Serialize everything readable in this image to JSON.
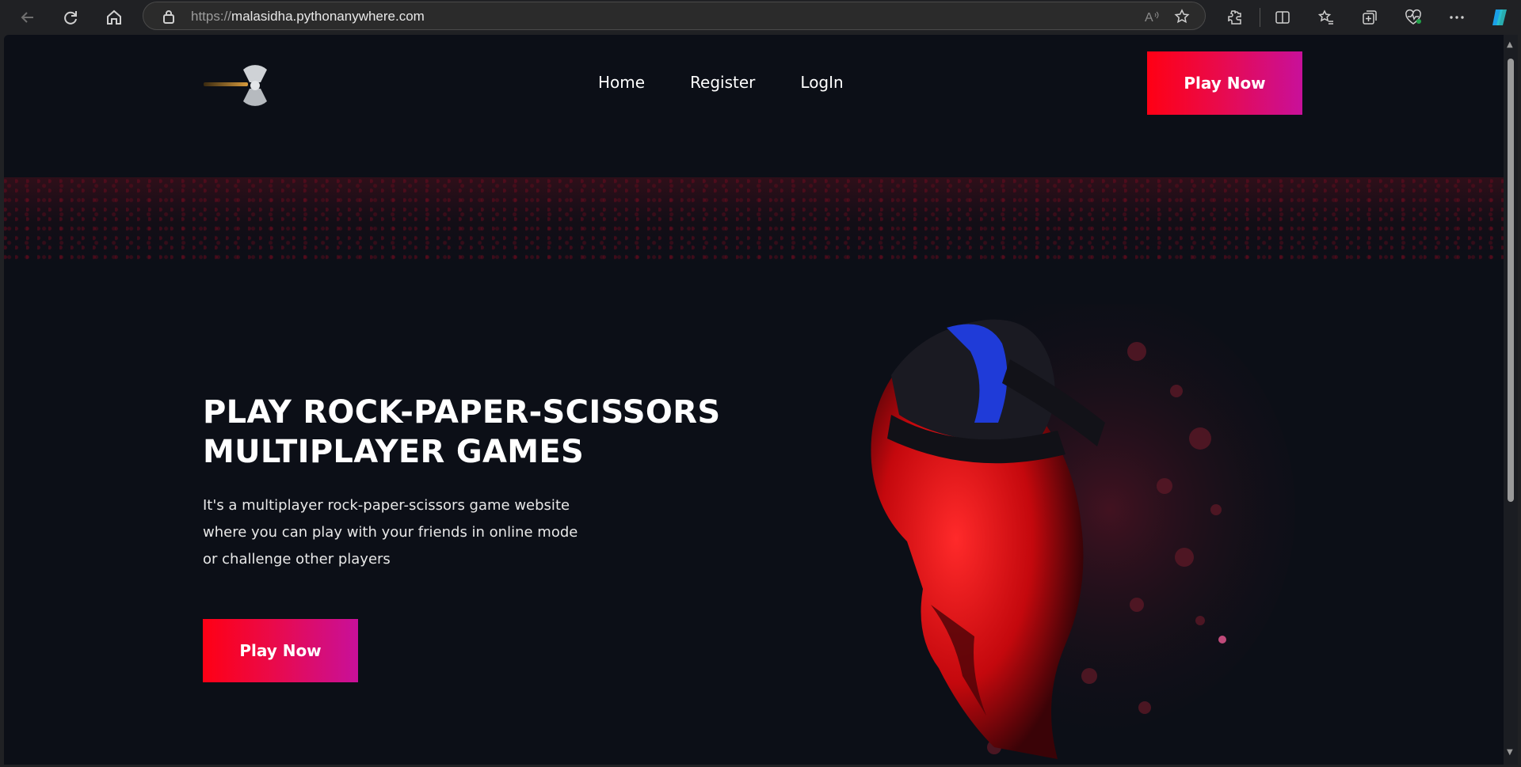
{
  "browser": {
    "url_scheme": "https://",
    "url_host": "malasidha.pythonanywhere.com"
  },
  "nav": {
    "links": [
      "Home",
      "Register",
      "LogIn"
    ],
    "cta": "Play Now"
  },
  "hero": {
    "title_line1": "PLAY ROCK-PAPER-SCISSORS",
    "title_line2": "MULTIPLAYER GAMES",
    "desc_line1": "It's a multiplayer rock-paper-scissors game website",
    "desc_line2": "where you can play with your friends in online mode",
    "desc_line3": "or challenge other players",
    "cta": "Play Now"
  },
  "colors": {
    "page_bg": "#0c0f17",
    "cta_gradient_start": "#ff0014",
    "cta_gradient_end": "#c8109a"
  }
}
